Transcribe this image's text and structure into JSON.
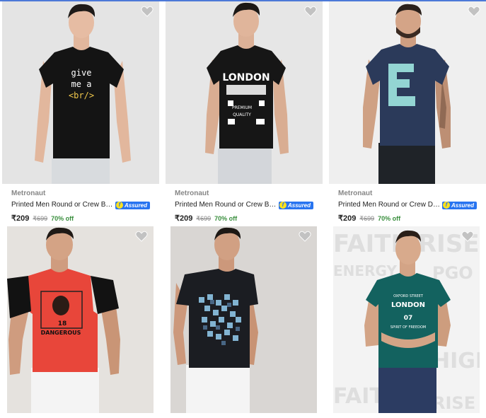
{
  "products": [
    {
      "brand": "Metronaut",
      "title": "Printed Men Round or Crew Black …",
      "assured": "Assured",
      "price": "₹209",
      "mrp": "₹699",
      "discount": "70% off",
      "shirt_text": [
        "give",
        "me a",
        "<br/>"
      ],
      "shirt_color": "#141414",
      "bg": "#e4e4e4"
    },
    {
      "brand": "Metronaut",
      "title": "Printed Men Round or Crew Black …",
      "assured": "Assured",
      "price": "₹209",
      "mrp": "₹699",
      "discount": "70% off",
      "shirt_text": [
        "LONDON",
        "PREMIUM",
        "QUALITY"
      ],
      "shirt_color": "#161616",
      "bg": "#e6e6e6"
    },
    {
      "brand": "Metronaut",
      "title": "Printed Men Round or Crew Dark …",
      "assured": "Assured",
      "price": "₹209",
      "mrp": "₹699",
      "discount": "70% off",
      "shirt_color": "#2b3a5a",
      "bg": "#efefef"
    },
    {
      "shirt_text": [
        "18",
        "DANGEROUS"
      ],
      "shirt_color": "#e8463a",
      "bg": "#e5e2de"
    },
    {
      "shirt_color": "#1b1d22",
      "bg": "#d9d6d3"
    },
    {
      "shirt_text": [
        "OXFORD STREET",
        "LONDON",
        "07",
        "SPIRIT OF FREEDOM"
      ],
      "shirt_color": "#13625f",
      "bg": "#f3f3f3",
      "bg_words": [
        "FAITH",
        "RISE",
        "ENERGY",
        "PGO",
        "HIGH",
        "FAITH",
        "RISE"
      ]
    }
  ],
  "colors": {
    "accent": "#2874f0",
    "discount": "#388e3c",
    "topbar": "#4c79d8"
  },
  "icons": {
    "wishlist": "heart-icon",
    "assured": "flipkart-assured-badge"
  }
}
